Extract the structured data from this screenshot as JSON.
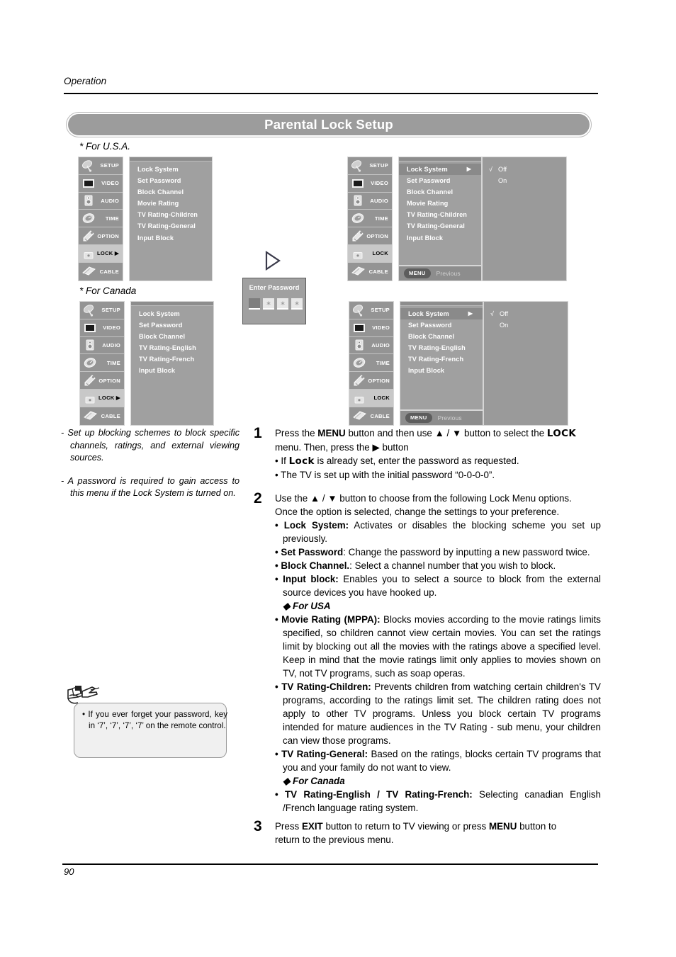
{
  "header": {
    "section_label": "Operation",
    "title": "Parental Lock Setup"
  },
  "captions": {
    "usa": "* For U.S.A.",
    "canada": "* For Canada"
  },
  "osd_sidebar": [
    {
      "label": "SETUP",
      "icon": "satellite-dish-icon"
    },
    {
      "label": "VIDEO",
      "icon": "tv-screen-icon"
    },
    {
      "label": "AUDIO",
      "icon": "speaker-icon"
    },
    {
      "label": "TIME",
      "icon": "clock-icon"
    },
    {
      "label": "OPTION",
      "icon": "key-icon"
    },
    {
      "label": "LOCK",
      "icon": "padlock-icon"
    },
    {
      "label": "CABLE",
      "icon": "cable-card-icon"
    }
  ],
  "osd_sidebar_lock_arrow": "LOCK ▶",
  "menu_usa": {
    "items": [
      "Lock System",
      "Set Password",
      "Block Channel",
      "Movie Rating",
      "TV Rating-Children",
      "TV Rating-General",
      "Input Block"
    ]
  },
  "menu_canada": {
    "items": [
      "Lock System",
      "Set Password",
      "Block Channel",
      "TV Rating-English",
      "TV Rating-French",
      "Input Block"
    ]
  },
  "menu_usa_open": {
    "items": [
      "Lock System",
      "Set Password",
      "Block Channel",
      "Movie Rating",
      "TV Rating-Children",
      "TV Rating-General",
      "Input Block"
    ],
    "selected": "Lock System",
    "selected_arrow": "▶",
    "choices": [
      "Off",
      "On"
    ],
    "checked": "Off",
    "check_glyph": "√",
    "footer_button": "MENU",
    "footer_label": "Previous"
  },
  "menu_canada_open": {
    "items": [
      "Lock System",
      "Set Password",
      "Block Channel",
      "TV Rating-English",
      "TV Rating-French",
      "Input Block"
    ],
    "selected": "Lock System",
    "selected_arrow": "▶",
    "choices": [
      "Off",
      "On"
    ],
    "checked": "Off",
    "check_glyph": "√",
    "footer_button": "MENU",
    "footer_label": "Previous"
  },
  "password_dialog": {
    "title": "Enter Password",
    "cells": [
      "",
      "∗",
      "∗",
      "∗"
    ]
  },
  "left_notes": [
    "- Set up blocking schemes to block specific channels, ratings, and external viewing sources.",
    "- A password is required to gain access to this menu if the Lock System is turned on."
  ],
  "note_bubble": {
    "icon": "hand-pointing-note-icon",
    "text": "• If you ever forget your password, key in ‘7’, ‘7’, ‘7’, ‘7’ on the remote control."
  },
  "steps": [
    {
      "num": "1",
      "lines": [
        {
          "type": "rich",
          "parts": [
            {
              "t": "Press the "
            },
            {
              "t": "MENU",
              "b": true
            },
            {
              "t": " button and then use "
            },
            {
              "t": "▲",
              "sym": true
            },
            {
              "t": " / "
            },
            {
              "t": "▼",
              "sym": true
            },
            {
              "t": " button to select the "
            },
            {
              "t": "LOCK",
              "lock": true
            }
          ]
        },
        {
          "type": "rich",
          "parts": [
            {
              "t": "menu. Then, press the "
            },
            {
              "t": "▶",
              "sym": true
            },
            {
              "t": " button"
            }
          ]
        },
        {
          "type": "bullet",
          "parts": [
            {
              "t": "• If "
            },
            {
              "t": "Lock",
              "lock": true
            },
            {
              "t": " is already set, enter the password as requested."
            }
          ]
        },
        {
          "type": "bullet",
          "parts": [
            {
              "t": "• The TV is set up with the initial password “0-0-0-0”."
            }
          ]
        }
      ]
    },
    {
      "num": "2",
      "lines": [
        {
          "type": "rich",
          "parts": [
            {
              "t": "Use the "
            },
            {
              "t": "▲",
              "sym": true
            },
            {
              "t": " / "
            },
            {
              "t": "▼",
              "sym": true
            },
            {
              "t": " button to choose from the following Lock Menu options."
            }
          ]
        },
        {
          "type": "rich",
          "parts": [
            {
              "t": "Once the option is selected, change the settings to your preference."
            }
          ]
        }
      ],
      "bullets": [
        {
          "label": "• Lock System:",
          "text": " Activates or disables the blocking scheme you set up previously."
        },
        {
          "label": "• Set Password",
          "text": ": Change the password by inputting a new password twice."
        },
        {
          "label": "• Block Channel.",
          "text": ": Select a channel number that you wish to block."
        },
        {
          "label": "• Input block:",
          "text": " Enables you to select a source to block from the external source devices you have hooked up."
        }
      ],
      "usa_heading": "◆ For USA",
      "usa_bullets": [
        {
          "label": "• Movie Rating (MPPA):",
          "text": " Blocks movies according to the movie ratings limits specified, so children cannot view certain movies. You can set the ratings limit by blocking out all the movies with the ratings above a specified level. Keep in mind that the movie ratings limit only applies to movies shown on TV, not TV programs, such as soap operas."
        },
        {
          "label": "• TV Rating-Children:",
          "text": " Prevents children from watching certain children's TV programs, according to the ratings limit set. The children rating does not apply to other TV programs. Unless you block certain TV programs intended for mature audiences in the TV Rating - sub menu, your children can view those programs."
        },
        {
          "label": "• TV Rating-General:",
          "text": " Based on the ratings, blocks certain TV programs that you and your family do not want to view."
        }
      ],
      "canada_heading": "◆ For Canada",
      "canada_bullets": [
        {
          "label": "• TV Rating-English / TV Rating-French:",
          "text": " Selecting canadian English /French language rating system."
        }
      ]
    },
    {
      "num": "3",
      "lines": [
        {
          "type": "rich",
          "parts": [
            {
              "t": "Press "
            },
            {
              "t": "EXIT",
              "b": true
            },
            {
              "t": " button to return to TV viewing or press "
            },
            {
              "t": "MENU",
              "b": true
            },
            {
              "t": " button to"
            }
          ]
        },
        {
          "type": "rich",
          "parts": [
            {
              "t": "return to the previous menu."
            }
          ]
        }
      ]
    }
  ],
  "footer": {
    "page_number": "90"
  }
}
